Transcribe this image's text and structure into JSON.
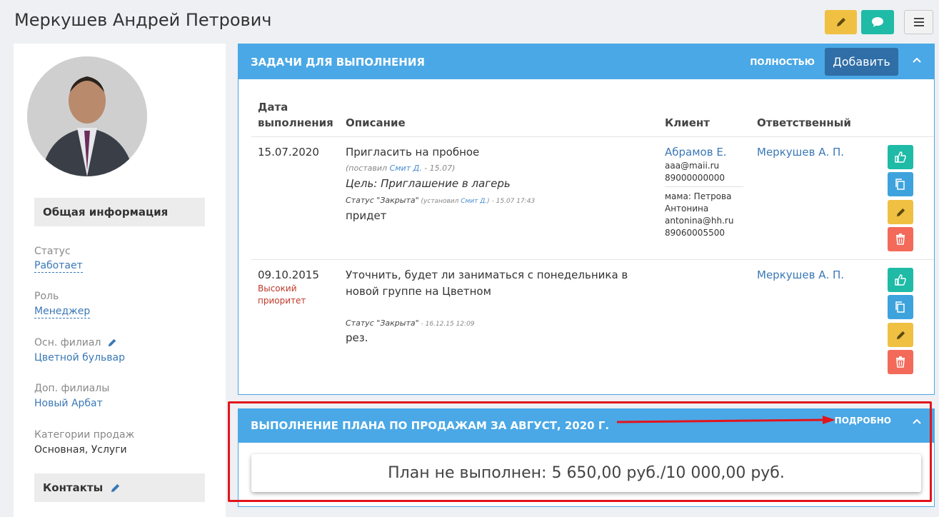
{
  "page": {
    "title": "Меркушев Андрей Петрович"
  },
  "profile": {
    "general_header": "Общая информация",
    "fields": [
      {
        "label": "Статус",
        "value": "Работает"
      },
      {
        "label": "Роль",
        "value": "Менеджер"
      },
      {
        "label": "Осн. филиал",
        "value": "Цветной бульвар"
      },
      {
        "label": "Доп. филиалы",
        "value": "Новый Арбат"
      },
      {
        "label": "Категории продаж",
        "value": "Основная, Услуги"
      }
    ],
    "contacts_header": "Контакты"
  },
  "tasks": {
    "title": "ЗАДАЧИ ДЛЯ ВЫПОЛНЕНИЯ",
    "full_link": "ПОЛНОСТЬЮ",
    "add_button": "Добавить",
    "columns": {
      "date_line1": "Дата",
      "date_line2": "выполнения",
      "description": "Описание",
      "client": "Клиент",
      "responsible": "Ответственный"
    },
    "rows": [
      {
        "date": "15.07.2020",
        "description": "Пригласить на пробное",
        "set_by_prefix": "(поставил ",
        "set_by_name": "Смит Д.",
        "set_by_suffix": " - 15.07)",
        "goal": "Цель: Приглашение в лагерь",
        "status": "Статус \"Закрыта\"",
        "status_by_prefix": " (установил ",
        "status_by_name": "Смит Д.",
        "status_by_suffix": ") - 15.07 17:43",
        "result": "придет",
        "client_name": "Абрамов Е.",
        "client_email": "aaa@maii.ru",
        "client_phone": "89000000000",
        "client_parent_line1": "мама: Петрова",
        "client_parent_line2": "Антонина",
        "client_parent_email": "antonina@hh.ru",
        "client_parent_phone": "89060005500",
        "responsible": "Меркушев А. П."
      },
      {
        "date": "09.10.2015",
        "priority_line1": "Высокий",
        "priority_line2": "приоритет",
        "description_line1": "Уточнить, будет ли заниматься с понедельника в",
        "description_line2": "новой группе на Цветном",
        "status": "Статус \"Закрыта\"",
        "status_time": " - 16.12.15 12:09",
        "result": "рез.",
        "responsible": "Меркушев А. П."
      }
    ]
  },
  "plan": {
    "title": "ВЫПОЛНЕНИЕ ПЛАНА ПО ПРОДАЖАМ ЗА АВГУСТ, 2020 Г.",
    "details_link": "ПОДРОБНО",
    "status_text": "План не выполнен: 5 650,00 руб./10 000,00 руб."
  },
  "colors": {
    "primary": "#4aa8e6",
    "success": "#1fbba6",
    "warning": "#f0c042",
    "danger": "#f36a5a",
    "info": "#3ea3dd",
    "annotation": "#e2141c"
  }
}
